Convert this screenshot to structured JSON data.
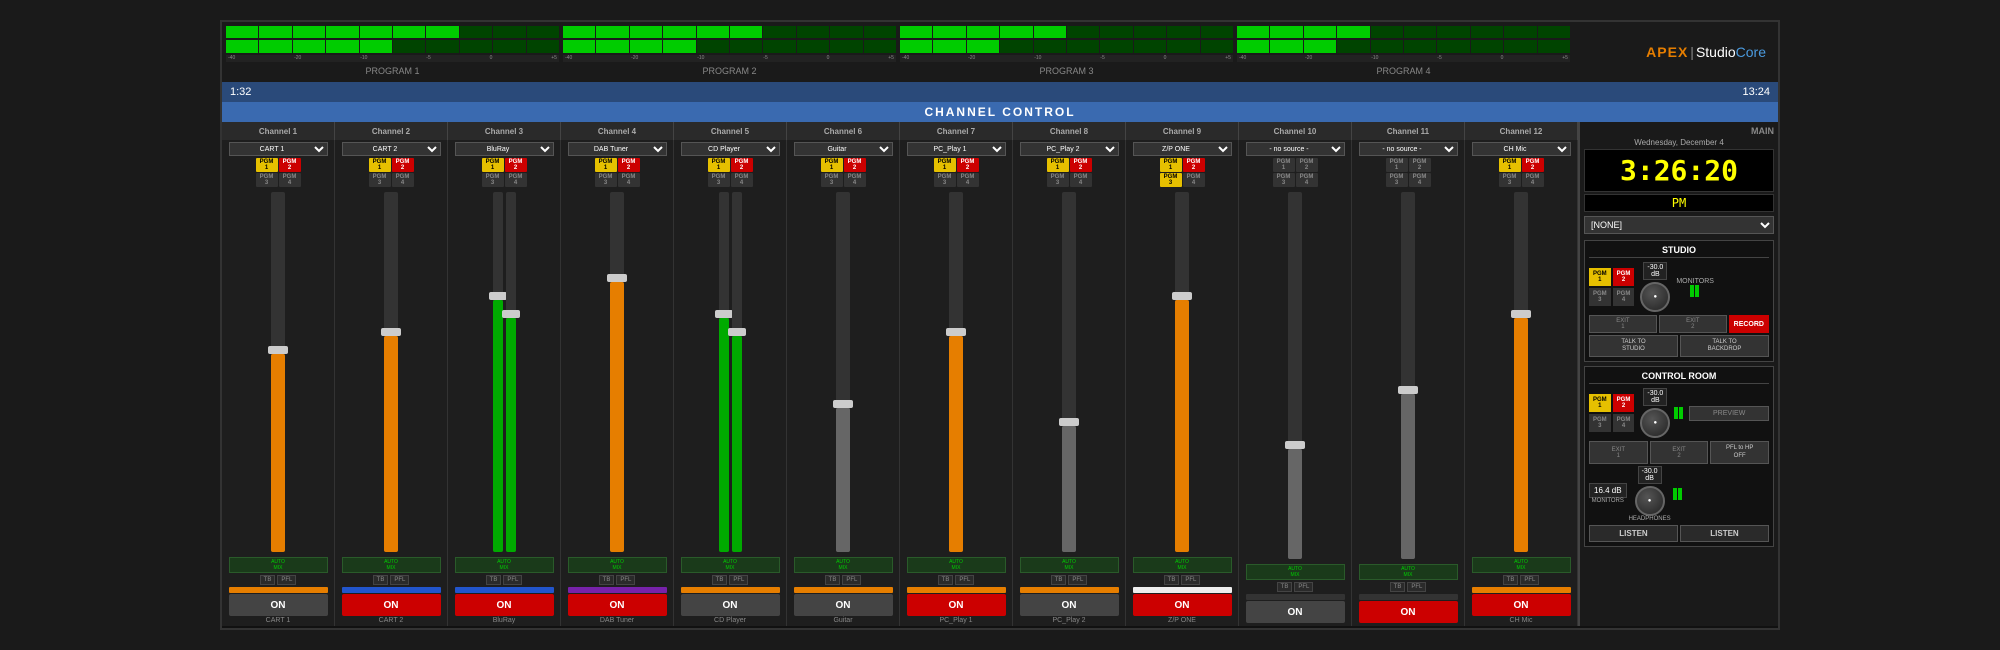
{
  "app": {
    "title": "StudioCore",
    "logo_text": "APEX",
    "studio_text": "Studio",
    "core_text": "Core"
  },
  "timecodes": {
    "left": "1:32",
    "right": "13:24"
  },
  "channel_control_label": "CHANNEL CONTROL",
  "clock": {
    "time": "3:26:20",
    "ampm": "PM",
    "date": "Wednesday, December 4"
  },
  "none_selector": "[NONE]",
  "channels": [
    {
      "id": 1,
      "label": "Channel 1",
      "source": "CART 1",
      "on": false,
      "bottom_label": "CART 1",
      "fader_pct": 55,
      "color": "orange"
    },
    {
      "id": 2,
      "label": "Channel 2",
      "source": "CART 2",
      "on": true,
      "bottom_label": "CART 2",
      "fader_pct": 60,
      "color": "blue"
    },
    {
      "id": 3,
      "label": "Channel 3",
      "source": "BluRay",
      "on": true,
      "bottom_label": "BluRay",
      "fader_pct": 70,
      "color": "blue"
    },
    {
      "id": 4,
      "label": "Channel 4",
      "source": "DAB Tuner",
      "on": true,
      "bottom_label": "DAB Tuner",
      "fader_pct": 75,
      "color": "purple"
    },
    {
      "id": 5,
      "label": "Channel 5",
      "source": "CD Player",
      "on": false,
      "bottom_label": "CD Player",
      "fader_pct": 65,
      "color": "orange"
    },
    {
      "id": 6,
      "label": "Channel 6",
      "source": "Guitar",
      "on": false,
      "bottom_label": "Guitar",
      "fader_pct": 40,
      "color": "orange"
    },
    {
      "id": 7,
      "label": "Channel 7",
      "source": "PC_Play 1",
      "on": true,
      "bottom_label": "PC_Play 1",
      "fader_pct": 60,
      "color": "orange"
    },
    {
      "id": 8,
      "label": "Channel 8",
      "source": "PC_Play 2",
      "on": false,
      "bottom_label": "PC_Play 2",
      "fader_pct": 35,
      "color": "orange"
    },
    {
      "id": 9,
      "label": "Channel 9",
      "source": "Z/P ONE",
      "on": true,
      "bottom_label": "Z/P ONE",
      "fader_pct": 70,
      "color": "white"
    },
    {
      "id": 10,
      "label": "Channel 10",
      "source": "- no source -",
      "on": false,
      "bottom_label": "",
      "fader_pct": 30,
      "color": "orange"
    },
    {
      "id": 11,
      "label": "Channel 11",
      "source": "- no source -",
      "on": true,
      "bottom_label": "",
      "fader_pct": 45,
      "color": "orange"
    },
    {
      "id": 12,
      "label": "Channel 12",
      "source": "CH Mic",
      "on": true,
      "bottom_label": "CH Mic",
      "fader_pct": 65,
      "color": "orange"
    }
  ],
  "studio_section": {
    "label": "STUDIO",
    "monitors_label": "MONITORS",
    "record_label": "RECORD",
    "talk_studio_label": "TALK TO\nSTUDIO",
    "talk_back_label": "TALK TO\nBACKDROP",
    "exit1": "EXIT\n1",
    "exit2": "EXIT\n2",
    "knob_db": "-30.0\ndB",
    "pgm_buttons": [
      "PGM\n1",
      "PGM\n2",
      "PGM\n3",
      "PGM\n4"
    ]
  },
  "control_room_section": {
    "label": "CONTROL ROOM",
    "preview_label": "PREVIEW",
    "pfl_hp_label": "PFL to HP\nOFF",
    "exit1": "EXIT\n1",
    "exit2": "EXIT\n2",
    "knob_db": "-30.0\ndB",
    "monitors_db": "16.4\ndB",
    "monitors_label": "MONITORS",
    "headphones_label": "HEADPHONES",
    "listen_label": "LISTEN",
    "pgm_buttons": [
      "PGM\n1",
      "PGM\n2",
      "PGM\n3",
      "PGM\n4"
    ]
  },
  "main_label": "MAIN"
}
